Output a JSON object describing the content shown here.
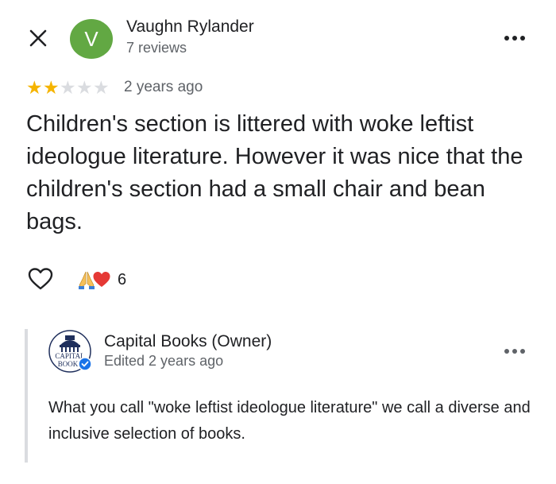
{
  "reviewer": {
    "avatar_letter": "V",
    "avatar_color": "#62a843",
    "name": "Vaughn Rylander",
    "meta": "7 reviews"
  },
  "review": {
    "rating": 2,
    "rating_max": 5,
    "age": "2 years ago",
    "text": "Children's section is littered with woke leftist ideologue literature. However it was nice that the children's section had a small chair and bean bags."
  },
  "reactions": {
    "icons": [
      "folded-hands-icon",
      "red-heart-icon"
    ],
    "count": "6"
  },
  "owner_reply": {
    "logo_text": "CAPITAL BOOKS",
    "name": "Capital Books (Owner)",
    "meta": "Edited 2 years ago",
    "text": "What you call \"woke leftist ideologue literature\" we call a diverse and inclusive selection of books."
  },
  "icons": {
    "close": "close-icon",
    "more": "more-options-icon",
    "like": "heart-outline-icon",
    "verified": "verified-badge-icon"
  },
  "colors": {
    "star_on": "#f5b400",
    "star_off": "#dadce0",
    "secondary_text": "#5f6368",
    "verified": "#1a73e8"
  }
}
